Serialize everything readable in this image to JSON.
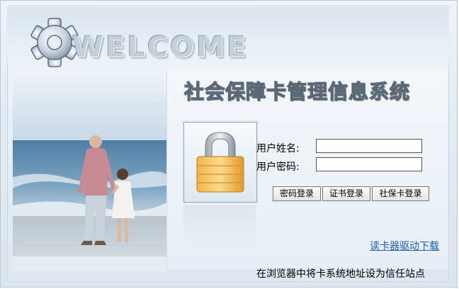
{
  "banner": {
    "welcome": "WELCOME"
  },
  "system": {
    "title": "社会保障卡管理信息系统"
  },
  "form": {
    "username_label": "用户姓名:",
    "password_label": "用户密码:",
    "username_value": "",
    "password_value": ""
  },
  "buttons": {
    "password_login": "密码登录",
    "cert_login": "证书登录",
    "card_login": "社保卡登录"
  },
  "links": {
    "driver_download": "读卡器驱动下载"
  },
  "footer": {
    "tip": "在浏览器中将卡系统地址设为信任站点"
  }
}
